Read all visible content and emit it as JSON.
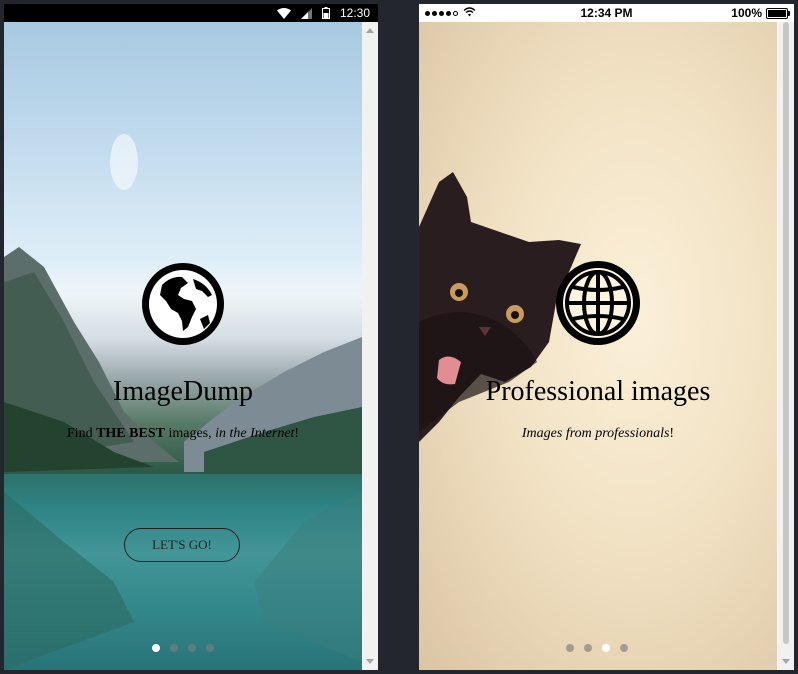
{
  "left_phone": {
    "status_bar": {
      "time": "12:30",
      "icons": [
        "wifi-icon",
        "cell-signal-icon",
        "battery-icon"
      ]
    },
    "slide": {
      "icon": "globe-americas-icon",
      "title": "ImageDump",
      "subtitle": {
        "before": "Find ",
        "bold": "THE BEST",
        "middle": " images, ",
        "italic": "in the Internet",
        "after": "!"
      },
      "button_label": "LET'S GO!"
    },
    "pager": {
      "count": 4,
      "active_index": 0
    }
  },
  "right_phone": {
    "status_bar": {
      "carrier_dots": 5,
      "time": "12:34 PM",
      "battery": "100%"
    },
    "slide": {
      "icon": "globe-grid-icon",
      "title": "Professional images",
      "subtitle": {
        "italic": "Images from professionals",
        "after": "!"
      }
    },
    "pager": {
      "count": 4,
      "active_index": 2
    }
  },
  "colors": {
    "backdrop": "#23262d",
    "dot_inactive": "#7c7c7c",
    "dot_active": "#ffffff"
  }
}
